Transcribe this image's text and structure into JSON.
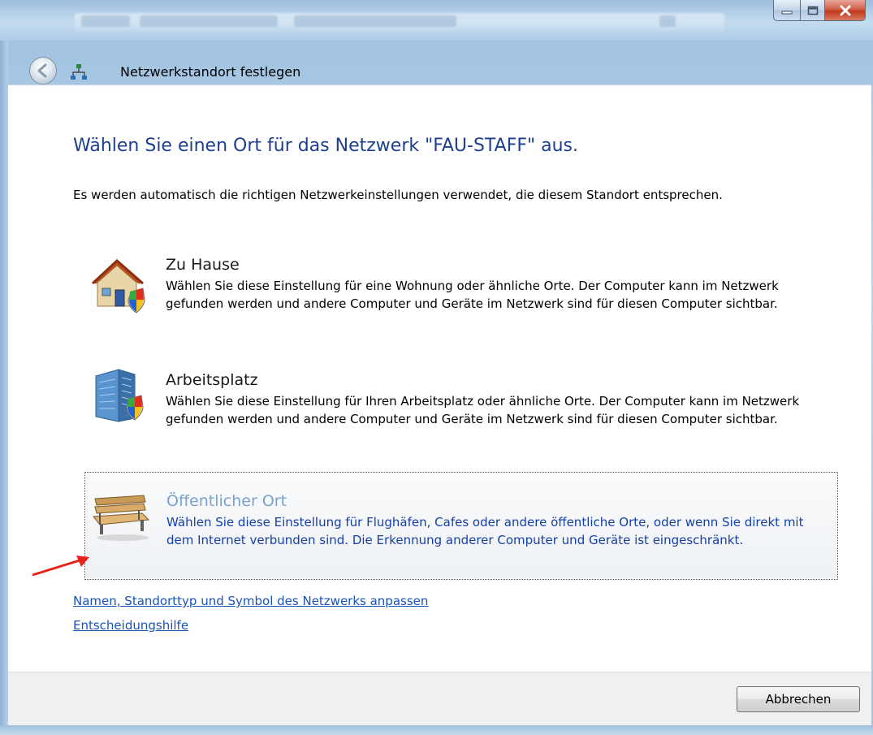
{
  "window": {
    "title": "Netzwerkstandort festlegen",
    "caption_buttons": [
      "minimize-icon",
      "maximize-icon",
      "close-icon"
    ]
  },
  "main": {
    "heading": "Wählen Sie einen Ort für das Netzwerk \"FAU-STAFF\" aus.",
    "intro": "Es werden automatisch die richtigen Netzwerkeinstellungen verwendet, die diesem Standort entsprechen.",
    "options": [
      {
        "title": "Zu Hause",
        "description": "Wählen Sie diese Einstellung für eine Wohnung oder ähnliche Orte. Der Computer kann im Netzwerk gefunden werden und andere Computer und Geräte im Netzwerk sind für diesen Computer sichtbar.",
        "icon": "house-icon"
      },
      {
        "title": "Arbeitsplatz",
        "description": "Wählen Sie diese Einstellung für Ihren Arbeitsplatz oder ähnliche Orte. Der Computer kann im Netzwerk gefunden werden und andere Computer und Geräte im Netzwerk sind für diesen Computer sichtbar.",
        "icon": "office-building-icon"
      },
      {
        "title": "Öffentlicher Ort",
        "description": "Wählen Sie diese Einstellung für Flughäfen, Cafes oder andere öffentliche Orte, oder wenn Sie direkt mit dem Internet verbunden sind. Die Erkennung anderer Computer und Geräte ist eingeschränkt.",
        "icon": "park-bench-icon"
      }
    ],
    "links": [
      "Namen, Standorttyp und Symbol des Netzwerks anpassen",
      "Entscheidungshilfe"
    ]
  },
  "footer": {
    "cancel_label": "Abbrechen"
  },
  "colors": {
    "heading": "#1e3e8e",
    "link": "#1a53b9",
    "highlight_title": "#7ba2cf",
    "highlight_desc": "#1540a8",
    "annotation_arrow": "#e8211b"
  }
}
